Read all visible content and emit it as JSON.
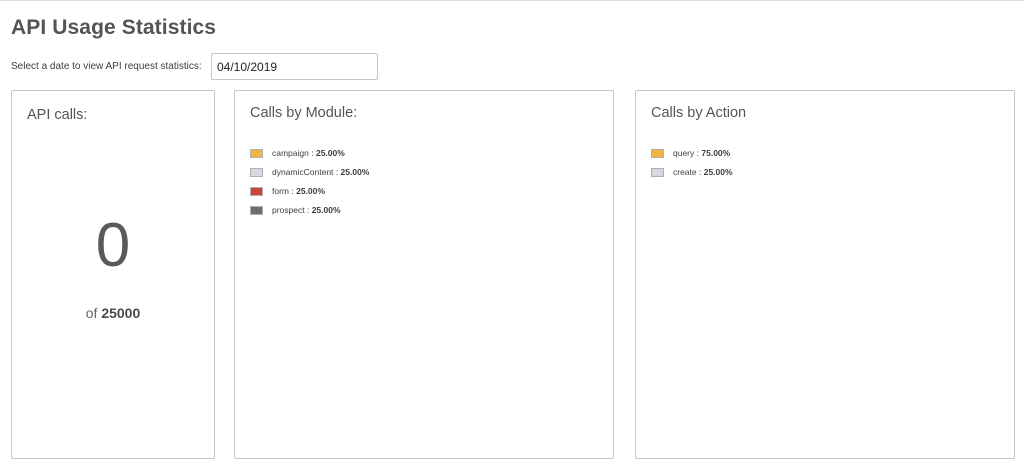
{
  "page": {
    "title": "API Usage Statistics",
    "date_label": "Select a date to view API request statistics:",
    "date_value": "04/10/2019"
  },
  "api_calls": {
    "title": "API calls:",
    "count": "0",
    "of_word": "of",
    "limit": "25000"
  },
  "calls_by_module": {
    "title": "Calls by Module:",
    "items": [
      {
        "label": "campaign :",
        "value": "25.00%",
        "color": "#f0b548"
      },
      {
        "label": "dynamicContent :",
        "value": "25.00%",
        "color": "#d8d8e0"
      },
      {
        "label": "form :",
        "value": "25.00%",
        "color": "#c9463d"
      },
      {
        "label": "prospect :",
        "value": "25.00%",
        "color": "#6e6e6e"
      }
    ]
  },
  "calls_by_action": {
    "title": "Calls by Action",
    "items": [
      {
        "label": "query :",
        "value": "75.00%",
        "color": "#f0b548"
      },
      {
        "label": "create :",
        "value": "25.00%",
        "color": "#d8d8e0"
      }
    ]
  }
}
